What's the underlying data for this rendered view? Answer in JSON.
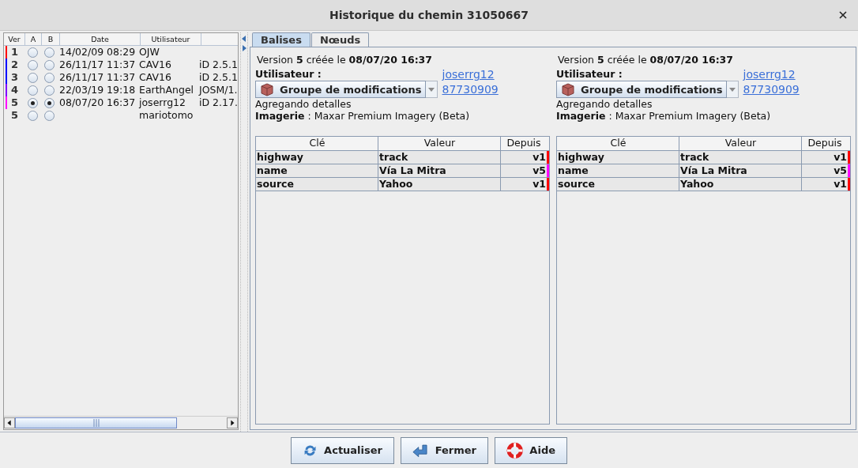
{
  "window": {
    "title": "Historique du chemin 31050667"
  },
  "history": {
    "columns": [
      "Ver",
      "A",
      "B",
      "Date",
      "Utilisateur"
    ],
    "rows": [
      {
        "version": "1",
        "a_selected": false,
        "b_selected": false,
        "date": "14/02/09 08:29",
        "user": "OJW",
        "color": "#ff0000"
      },
      {
        "version": "2",
        "a_selected": false,
        "b_selected": false,
        "date": "26/11/17 11:37",
        "user": "CAV16",
        "client": "iD 2.5.1",
        "color": "#0000ff"
      },
      {
        "version": "3",
        "a_selected": false,
        "b_selected": false,
        "date": "26/11/17 11:37",
        "user": "CAV16",
        "client": "iD 2.5.1",
        "color": "#0000ff"
      },
      {
        "version": "4",
        "a_selected": false,
        "b_selected": false,
        "date": "22/03/19 19:18",
        "user": "EarthAngel",
        "client": "JOSM/1.",
        "color": "#8000ff"
      },
      {
        "version": "5",
        "a_selected": true,
        "b_selected": true,
        "date": "08/07/20 16:37",
        "user": "joserrg12",
        "client": "iD 2.17.",
        "color": "#ff00ff"
      },
      {
        "version": "5",
        "a_selected": false,
        "b_selected": false,
        "user": "mariotomo"
      }
    ]
  },
  "tabs": [
    {
      "label": "Balises",
      "selected": true
    },
    {
      "label": "Nœuds",
      "selected": false
    }
  ],
  "versions": [
    {
      "heading": "Version **5** créée le **08/07/20 16:37**",
      "user_label": "Utilisateur :",
      "user_link": "joserrg12",
      "changeset_label": "Groupe de modifications",
      "changeset_link": "87730909",
      "comment": "Agregando detalles",
      "imagery": "**Imagerie** : Maxar Premium Imagery (Beta)",
      "columns": [
        "Clé",
        "Valeur",
        "Depuis"
      ],
      "tags": [
        {
          "key": "highway",
          "value": "track",
          "since": "v1",
          "color": "#ff0000"
        },
        {
          "key": "name",
          "value": "Vía La Mitra",
          "since": "v5",
          "color": "#ff00ff"
        },
        {
          "key": "source",
          "value": "Yahoo",
          "since": "v1",
          "color": "#ff0000"
        }
      ]
    },
    {
      "heading": "Version **5** créée le **08/07/20 16:37**",
      "user_label": "Utilisateur :",
      "user_link": "joserrg12",
      "changeset_label": "Groupe de modifications",
      "changeset_link": "87730909",
      "comment": "Agregando detalles",
      "imagery": "**Imagerie** : Maxar Premium Imagery (Beta)",
      "columns": [
        "Clé",
        "Valeur",
        "Depuis"
      ],
      "tags": [
        {
          "key": "highway",
          "value": "track",
          "since": "v1",
          "color": "#ff0000"
        },
        {
          "key": "name",
          "value": "Vía La Mitra",
          "since": "v5",
          "color": "#ff00ff"
        },
        {
          "key": "source",
          "value": "Yahoo",
          "since": "v1",
          "color": "#ff0000"
        }
      ]
    }
  ],
  "buttons": [
    {
      "label": "Actualiser",
      "kind": "refresh"
    },
    {
      "label": "Fermer",
      "kind": "back"
    },
    {
      "label": "Aide",
      "kind": "help"
    }
  ]
}
